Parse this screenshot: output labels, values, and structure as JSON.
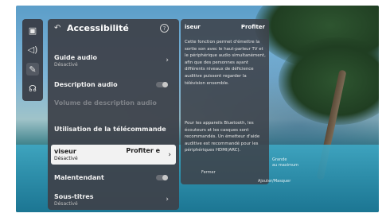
{
  "rail": {
    "icons": [
      "picture-icon",
      "sound-icon",
      "tools-icon",
      "support-icon"
    ]
  },
  "panel": {
    "title": "Accessibilité",
    "help_symbol": "?",
    "back_symbol": "↶",
    "items": [
      {
        "title": "Guide audio",
        "subtitle": "Désactivé"
      },
      {
        "title": "Description audio"
      },
      {
        "title": "Volume de description audio"
      },
      {
        "section": "Utilisation de la télécommande"
      },
      {
        "title": "viseur",
        "subtitle": "Désactivé",
        "right_text": "Profiter e"
      },
      {
        "title": "Malentendant"
      },
      {
        "title": "Sous-titres",
        "subtitle": "Désactivé"
      }
    ]
  },
  "info": {
    "title_left": "iseur",
    "title_right": "Profiter",
    "paragraph1": "Cette fonction permet d'émettre la sortie son avec le haut-parleur TV et le périphérique audio simultanément, afin que des personnes ayant différents niveaux de déficience auditive puissent regarder la télévision ensemble.",
    "paragraph2": "Pour les appareils Bluetooth, les écouteurs et les casques sont recommandés. Un émetteur d'aide auditive est recommandé pour les périphériques HDMI(ARC)."
  },
  "background_osd": {
    "fermer": "Fermer",
    "ajouter": "Ajouter/Masquer",
    "grande": "Grande",
    "ecran": "au maximum"
  },
  "colors": {
    "panel_bg": "#3e424a",
    "focus_bg": "#f2f2f2"
  }
}
